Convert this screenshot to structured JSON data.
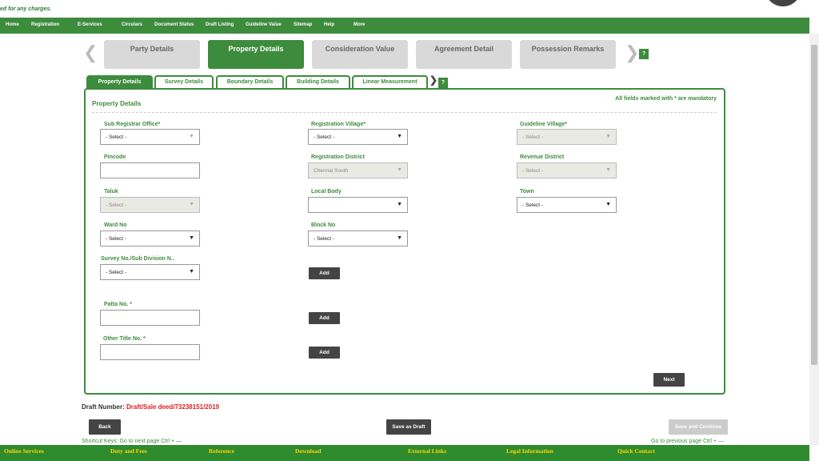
{
  "top_note": "ed for any charges.",
  "nav": [
    "Home",
    "Registration",
    "E-Services",
    "Circulars",
    "Document Status",
    "Draft Listing",
    "Guideline Value",
    "Sitemap",
    "Help",
    "More"
  ],
  "steps": [
    {
      "label": "Party Details"
    },
    {
      "label": "Property Details"
    },
    {
      "label": "Consideration Value"
    },
    {
      "label": "Agreement Detail"
    },
    {
      "label": "Possession Remarks"
    }
  ],
  "help_label": "?",
  "subtabs": [
    {
      "label": "Property Details"
    },
    {
      "label": "Survey Details"
    },
    {
      "label": "Boundary Details"
    },
    {
      "label": "Building Details"
    },
    {
      "label": "Linear Measurement"
    }
  ],
  "form": {
    "title": "Property Details",
    "mandatory_note": "All fields marked with * are mandatory",
    "sub_registrar_office": {
      "label": "Sub Registrar Office*",
      "value": "- Select -"
    },
    "registration_village": {
      "label": "Registration Village*",
      "value": "- Select -"
    },
    "guideline_village": {
      "label": "Guideline Village*",
      "value": "- Select -"
    },
    "pincode": {
      "label": "Pincode",
      "value": ""
    },
    "registration_district": {
      "label": "Registration District",
      "value": "Chennai South"
    },
    "revenue_district": {
      "label": "Revenue District",
      "value": "- Select -"
    },
    "taluk": {
      "label": "Taluk",
      "value": "- Select -"
    },
    "local_body": {
      "label": "Local Body",
      "value": ""
    },
    "town": {
      "label": "Town",
      "value": "- Select -"
    },
    "ward_no": {
      "label": "Ward No",
      "value": "- Select -"
    },
    "block_no": {
      "label": "Block No",
      "value": "- Select -"
    },
    "survey_no": {
      "label": "Survey No./Sub Division N..",
      "value": "- Select -"
    },
    "patta_no": {
      "label": "Patta No. *",
      "value": ""
    },
    "other_title_no": {
      "label": "Other Title No. *",
      "value": ""
    },
    "add_label": "Add",
    "next_label": "Next"
  },
  "draft": {
    "label": "Draft Number:",
    "value": "Draft/Sale deed/73238151/2019"
  },
  "actions": {
    "back": "Back",
    "save_draft": "Save as Draft",
    "save_continue": "Save and Continue"
  },
  "shortcuts": {
    "next": "Shortcut Keys: Go to next page Ctrl + —",
    "prev": "Go to previous page Ctrl + —"
  },
  "footer": [
    "Online Services",
    "Duty and Fees",
    "Reference",
    "Download",
    "External Links",
    "Legal Information",
    "Quick Contact"
  ],
  "colors": {
    "brand_green": "#3d8b3d",
    "footer_green": "#2e8b2e",
    "footer_text": "#ffd700",
    "draft_red": "#e02020"
  }
}
